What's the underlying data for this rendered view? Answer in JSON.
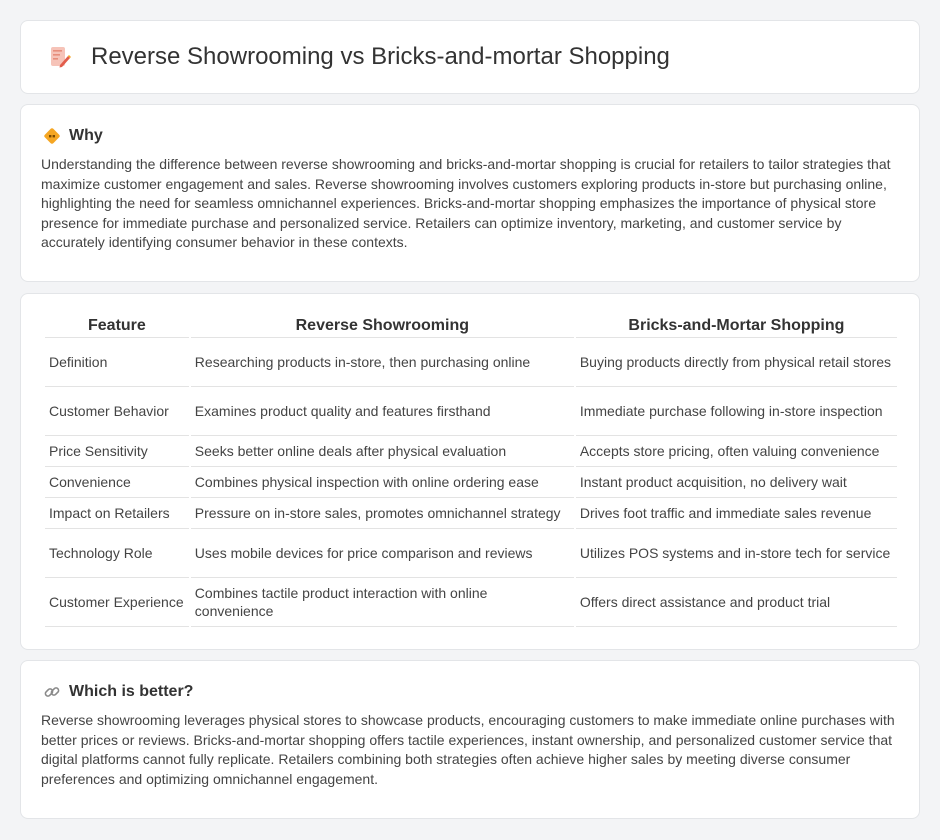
{
  "title": "Reverse Showrooming vs Bricks-and-mortar Shopping",
  "why": {
    "heading": "Why",
    "body": "Understanding the difference between reverse showrooming and bricks-and-mortar shopping is crucial for retailers to tailor strategies that maximize customer engagement and sales. Reverse showrooming involves customers exploring products in-store but purchasing online, highlighting the need for seamless omnichannel experiences. Bricks-and-mortar shopping emphasizes the importance of physical store presence for immediate purchase and personalized service. Retailers can optimize inventory, marketing, and customer service by accurately identifying consumer behavior in these contexts."
  },
  "table": {
    "headers": [
      "Feature",
      "Reverse Showrooming",
      "Bricks-and-Mortar Shopping"
    ],
    "rows": [
      [
        "Definition",
        "Researching products in-store, then purchasing online",
        "Buying products directly from physical retail stores"
      ],
      [
        "Customer Behavior",
        "Examines product quality and features firsthand",
        "Immediate purchase following in-store inspection"
      ],
      [
        "Price Sensitivity",
        "Seeks better online deals after physical evaluation",
        "Accepts store pricing, often valuing convenience"
      ],
      [
        "Convenience",
        "Combines physical inspection with online ordering ease",
        "Instant product acquisition, no delivery wait"
      ],
      [
        "Impact on Retailers",
        "Pressure on in-store sales, promotes omnichannel strategy",
        "Drives foot traffic and immediate sales revenue"
      ],
      [
        "Technology Role",
        "Uses mobile devices for price comparison and reviews",
        "Utilizes POS systems and in-store tech for service"
      ],
      [
        "Customer Experience",
        "Combines tactile product interaction with online convenience",
        "Offers direct assistance and product trial"
      ]
    ]
  },
  "better": {
    "heading": "Which is better?",
    "body": "Reverse showrooming leverages physical stores to showcase products, encouraging customers to make immediate online purchases with better prices or reviews. Bricks-and-mortar shopping offers tactile experiences, instant ownership, and personalized customer service that digital platforms cannot fully replicate. Retailers combining both strategies often achieve higher sales by meeting diverse consumer preferences and optimizing omnichannel engagement."
  },
  "icons": {
    "title": "document-pencil-icon",
    "why": "diamond-sign-icon",
    "better": "link-icon"
  },
  "colors": {
    "page_bg": "#f3f4f6",
    "card_bg": "#ffffff",
    "accent_orange": "#f5a623",
    "icon_red": "#e25c4b"
  }
}
